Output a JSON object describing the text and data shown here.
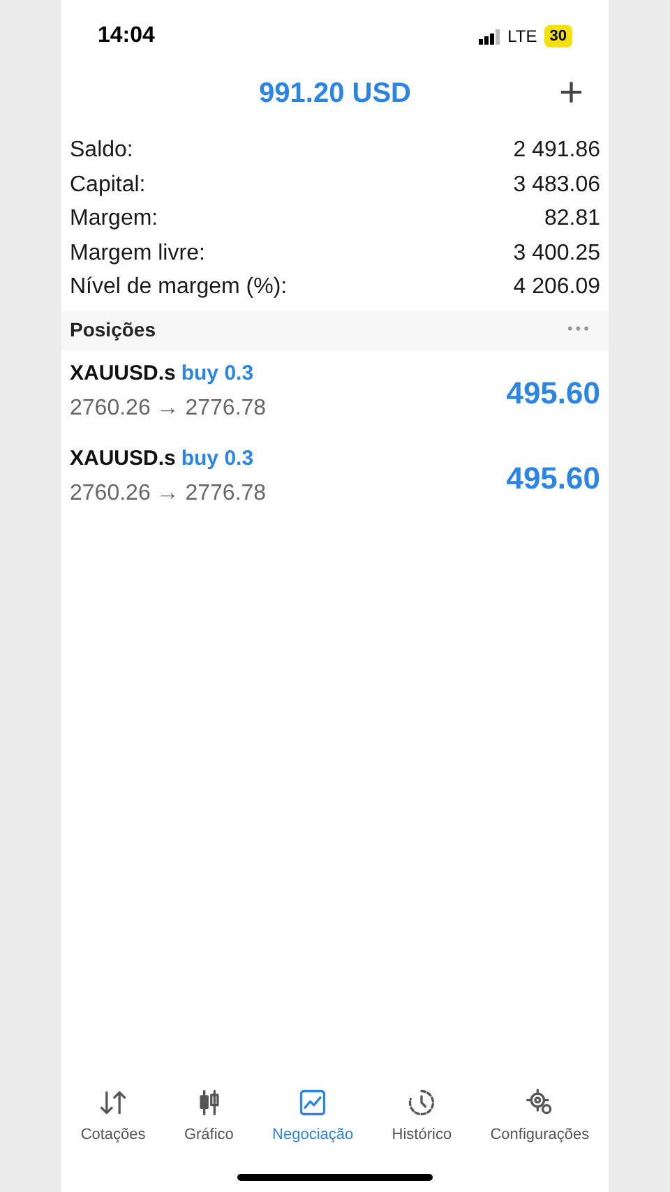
{
  "status_bar": {
    "time": "14:04",
    "network": "LTE",
    "battery": "30"
  },
  "header": {
    "title": "991.20 USD",
    "add": "+"
  },
  "summary": [
    {
      "label": "Saldo:",
      "value": "2 491.86"
    },
    {
      "label": "Capital:",
      "value": "3 483.06"
    },
    {
      "label": "Margem:",
      "value": "82.81"
    },
    {
      "label": "Margem livre:",
      "value": "3 400.25"
    },
    {
      "label": "Nível de margem (%):",
      "value": "4 206.09"
    }
  ],
  "positions": {
    "title": "Posições",
    "more": "•••",
    "items": [
      {
        "symbol": "XAUUSD.s",
        "side": "buy 0.3",
        "prices": "2760.26 → 2776.78",
        "profit": "495.60"
      },
      {
        "symbol": "XAUUSD.s",
        "side": "buy 0.3",
        "prices": "2760.26 → 2776.78",
        "profit": "495.60"
      }
    ]
  },
  "tabs": [
    {
      "label": "Cotações",
      "selected": false
    },
    {
      "label": "Gráfico",
      "selected": false
    },
    {
      "label": "Negociação",
      "selected": true
    },
    {
      "label": "Histórico",
      "selected": false
    },
    {
      "label": "Configurações",
      "selected": false
    }
  ]
}
